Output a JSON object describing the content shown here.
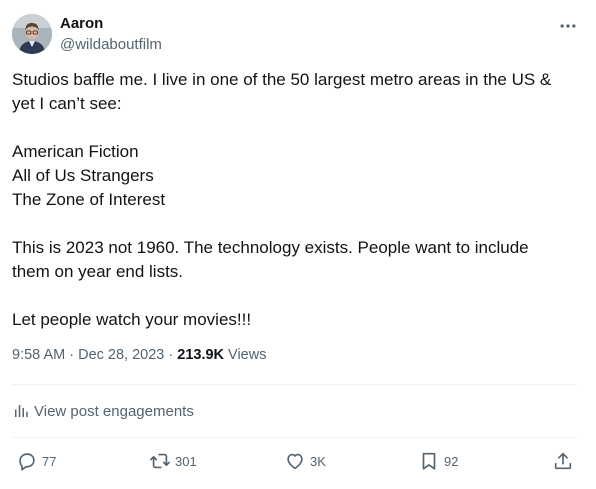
{
  "author": {
    "name": "Aaron",
    "handle": "@wildaboutfilm"
  },
  "post": {
    "lines": [
      "Studios baffle me. I live in one of the 50 largest metro areas in the US &",
      "yet I can’t see:",
      "",
      "American Fiction",
      "All of Us Strangers",
      "The Zone of Interest",
      "",
      "This is 2023 not 1960. The technology exists. People want to include",
      "them on year end lists.",
      "",
      "Let people watch your movies!!!"
    ],
    "time": "9:58 AM",
    "separator1": " · ",
    "date": "Dec 28, 2023",
    "separator2": " · ",
    "views_count": "213.9K",
    "views_label": " Views"
  },
  "engagements_label": "View post engagements",
  "actions": {
    "replies": "77",
    "reposts": "301",
    "likes": "3K",
    "bookmarks": "92"
  },
  "icons": {
    "more": "more-horizontal-icon",
    "analytics": "analytics-bars-icon",
    "reply": "reply-bubble-icon",
    "repost": "repost-arrows-icon",
    "like": "heart-icon",
    "bookmark": "bookmark-icon",
    "share": "share-upload-icon"
  },
  "colors": {
    "text": "#0f1419",
    "secondary": "#536471",
    "divider": "#eff3f4"
  }
}
